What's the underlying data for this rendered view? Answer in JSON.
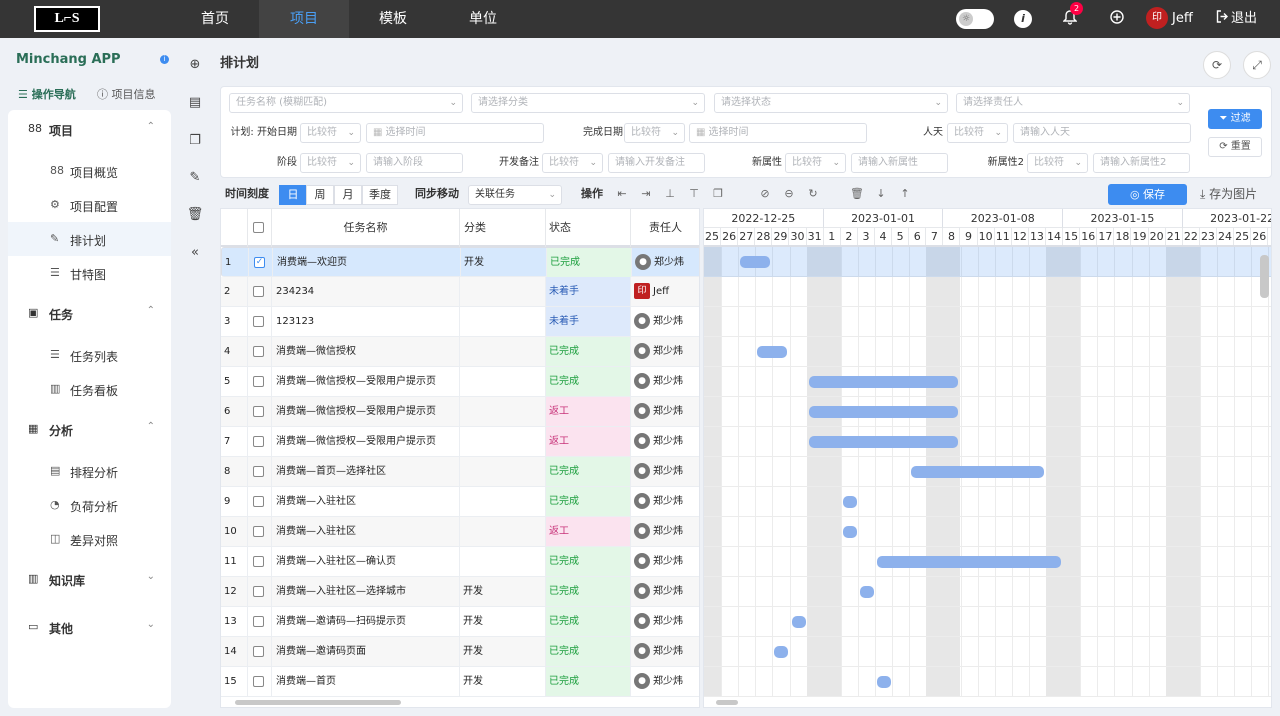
{
  "topbar": {
    "logo_text": "L⌐S",
    "nav": [
      "首页",
      "项目",
      "模板",
      "单位"
    ],
    "active_nav": "项目",
    "toggle_icon": "☼",
    "notification_count": "2",
    "user_name": "Jeff",
    "user_avatar_text": "印",
    "logout_label": "退出"
  },
  "app": {
    "name": "Minchang APP",
    "tabs": [
      "操作导航",
      "项目信息"
    ]
  },
  "sidebar": {
    "groups": [
      {
        "label": "项目",
        "icon": "88",
        "chevron": "⌃",
        "items": [
          {
            "label": "项目概览",
            "icon": "88"
          },
          {
            "label": "项目配置",
            "icon": "⚙"
          },
          {
            "label": "排计划",
            "icon": "✎"
          },
          {
            "label": "甘特图",
            "icon": "☰"
          }
        ]
      },
      {
        "label": "任务",
        "icon": "▣",
        "chevron": "⌃",
        "items": [
          {
            "label": "任务列表",
            "icon": "☰"
          },
          {
            "label": "任务看板",
            "icon": "▥"
          }
        ]
      },
      {
        "label": "分析",
        "icon": "▦",
        "chevron": "⌃",
        "items": [
          {
            "label": "排程分析",
            "icon": "▤"
          },
          {
            "label": "负荷分析",
            "icon": "◔"
          },
          {
            "label": "差异对照",
            "icon": "◫"
          }
        ]
      },
      {
        "label": "知识库",
        "icon": "▥",
        "chevron": "⌄",
        "items": []
      },
      {
        "label": "其他",
        "icon": "▭",
        "chevron": "⌄",
        "items": []
      }
    ]
  },
  "page": {
    "title": "排计划"
  },
  "filters": {
    "task_name_placeholder": "任务名称 (模糊匹配)",
    "category_placeholder": "请选择分类",
    "status_placeholder": "请选择状态",
    "owner_placeholder": "请选择责任人",
    "plan_start_label": "计划: 开始日期",
    "compare_placeholder": "比较符",
    "select_time_placeholder": "选择时间",
    "finish_date_label": "完成日期",
    "person_days_label": "人天",
    "person_days_placeholder": "请输入人天",
    "stage_label": "阶段",
    "stage_placeholder": "请输入阶段",
    "dev_note_label": "开发备注",
    "dev_note_placeholder": "请输入开发备注",
    "new_attr_label": "新属性",
    "new_attr_placeholder": "请输入新属性",
    "new_attr2_label": "新属性2",
    "new_attr2_placeholder": "请输入新属性2",
    "filter_button": "过滤",
    "reset_button": "重置"
  },
  "toolbar": {
    "scale_label": "时间刻度",
    "scales": [
      "日",
      "周",
      "月",
      "季度"
    ],
    "active_scale": "日",
    "sync_label": "同步移动",
    "link_select": "关联任务",
    "ops_label": "操作",
    "save_button": "保存",
    "export_button": "存为图片"
  },
  "table": {
    "headers": [
      "任务名称",
      "分类",
      "状态",
      "责任人"
    ],
    "rows": [
      {
        "no": "1",
        "checked": true,
        "name": "消费端—欢迎页",
        "category": "开发",
        "status": "已完成",
        "status_type": "done",
        "owner": "郑少炜",
        "avatar": "gray"
      },
      {
        "no": "2",
        "checked": false,
        "name": "234234",
        "category": "",
        "status": "未着手",
        "status_type": "todo",
        "owner": "Jeff",
        "avatar": "red"
      },
      {
        "no": "3",
        "checked": false,
        "name": "123123",
        "category": "",
        "status": "未着手",
        "status_type": "todo",
        "owner": "郑少炜",
        "avatar": "gray"
      },
      {
        "no": "4",
        "checked": false,
        "name": "消费端—微信授权",
        "category": "",
        "status": "已完成",
        "status_type": "done",
        "owner": "郑少炜",
        "avatar": "gray"
      },
      {
        "no": "5",
        "checked": false,
        "name": "消费端—微信授权—受限用户提示页",
        "category": "",
        "status": "已完成",
        "status_type": "done",
        "owner": "郑少炜",
        "avatar": "gray"
      },
      {
        "no": "6",
        "checked": false,
        "name": "消费端—微信授权—受限用户提示页",
        "category": "",
        "status": "返工",
        "status_type": "redo",
        "owner": "郑少炜",
        "avatar": "gray"
      },
      {
        "no": "7",
        "checked": false,
        "name": "消费端—微信授权—受限用户提示页",
        "category": "",
        "status": "返工",
        "status_type": "redo",
        "owner": "郑少炜",
        "avatar": "gray"
      },
      {
        "no": "8",
        "checked": false,
        "name": "消费端—首页—选择社区",
        "category": "",
        "status": "已完成",
        "status_type": "done",
        "owner": "郑少炜",
        "avatar": "gray"
      },
      {
        "no": "9",
        "checked": false,
        "name": "消费端—入驻社区",
        "category": "",
        "status": "已完成",
        "status_type": "done",
        "owner": "郑少炜",
        "avatar": "gray"
      },
      {
        "no": "10",
        "checked": false,
        "name": "消费端—入驻社区",
        "category": "",
        "status": "返工",
        "status_type": "redo",
        "owner": "郑少炜",
        "avatar": "gray"
      },
      {
        "no": "11",
        "checked": false,
        "name": "消费端—入驻社区—确认页",
        "category": "",
        "status": "已完成",
        "status_type": "done",
        "owner": "郑少炜",
        "avatar": "gray"
      },
      {
        "no": "12",
        "checked": false,
        "name": "消费端—入驻社区—选择城市",
        "category": "开发",
        "status": "已完成",
        "status_type": "done",
        "owner": "郑少炜",
        "avatar": "gray"
      },
      {
        "no": "13",
        "checked": false,
        "name": "消费端—邀请码—扫码提示页",
        "category": "开发",
        "status": "已完成",
        "status_type": "done",
        "owner": "郑少炜",
        "avatar": "gray"
      },
      {
        "no": "14",
        "checked": false,
        "name": "消费端—邀请码页面",
        "category": "开发",
        "status": "已完成",
        "status_type": "done",
        "owner": "郑少炜",
        "avatar": "gray"
      },
      {
        "no": "15",
        "checked": false,
        "name": "消费端—首页",
        "category": "开发",
        "status": "已完成",
        "status_type": "done",
        "owner": "郑少炜",
        "avatar": "gray"
      }
    ]
  },
  "gantt": {
    "weeks": [
      "2022-12-25",
      "2023-01-01",
      "2023-01-08",
      "2023-01-15",
      "2023-01-22"
    ],
    "days": [
      "25",
      "26",
      "27",
      "28",
      "29",
      "30",
      "31",
      "1",
      "2",
      "3",
      "4",
      "5",
      "6",
      "7",
      "8",
      "9",
      "10",
      "11",
      "12",
      "13",
      "14",
      "15",
      "16",
      "17",
      "18",
      "19",
      "20",
      "21",
      "22",
      "23",
      "24",
      "25",
      "26"
    ],
    "bars": [
      {
        "row": 1,
        "start": "2022-12-27",
        "end": "2022-12-28"
      },
      {
        "row": 4,
        "start": "2022-12-28",
        "end": "2022-12-29"
      },
      {
        "row": 5,
        "start": "2022-12-31",
        "end": "2023-01-08"
      },
      {
        "row": 6,
        "start": "2022-12-31",
        "end": "2023-01-08"
      },
      {
        "row": 7,
        "start": "2022-12-31",
        "end": "2023-01-08"
      },
      {
        "row": 8,
        "start": "2023-01-06",
        "end": "2023-01-13"
      },
      {
        "row": 9,
        "start": "2023-01-02",
        "end": "2023-01-02"
      },
      {
        "row": 10,
        "start": "2023-01-02",
        "end": "2023-01-02"
      },
      {
        "row": 11,
        "start": "2023-01-04",
        "end": "2023-01-14"
      },
      {
        "row": 12,
        "start": "2023-01-03",
        "end": "2023-01-03"
      },
      {
        "row": 13,
        "start": "2022-12-30",
        "end": "2022-12-30"
      },
      {
        "row": 14,
        "start": "2022-12-29",
        "end": "2022-12-29"
      },
      {
        "row": 15,
        "start": "2023-01-04",
        "end": "2023-01-04"
      }
    ]
  }
}
